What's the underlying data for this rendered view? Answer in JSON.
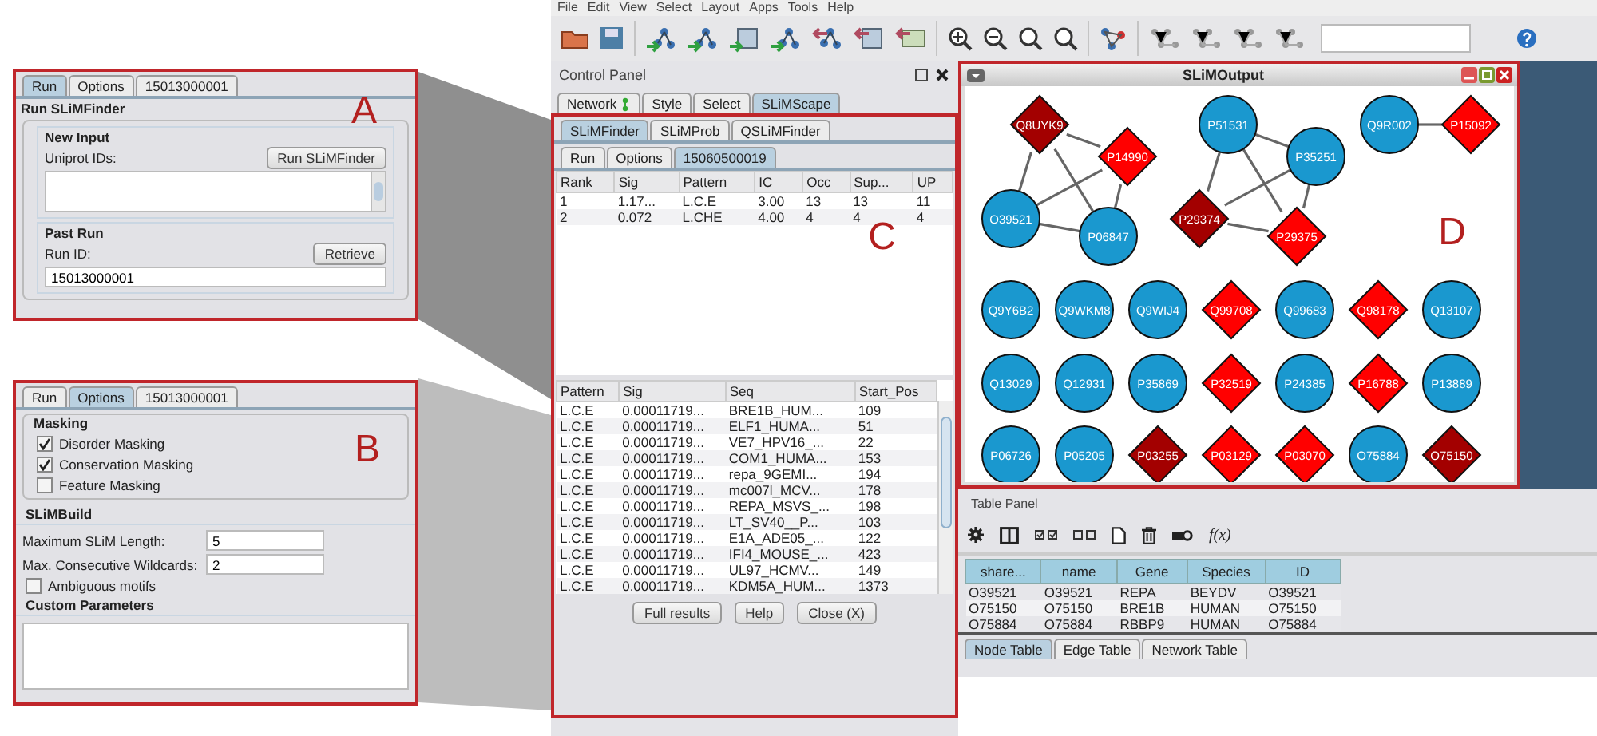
{
  "panel_a": {
    "label": "A",
    "tabs": [
      {
        "label": "Run",
        "selected": true
      },
      {
        "label": "Options",
        "selected": false
      },
      {
        "label": "15013000001",
        "selected": false
      }
    ],
    "title": "Run SLiMFinder",
    "new_input": {
      "heading": "New Input",
      "field_label": "Uniprot IDs:",
      "button": "Run SLiMFinder"
    },
    "past_run": {
      "heading": "Past Run",
      "field_label": "Run ID:",
      "button": "Retrieve",
      "value": "15013000001"
    }
  },
  "panel_b": {
    "label": "B",
    "tabs": [
      {
        "label": "Run",
        "selected": false
      },
      {
        "label": "Options",
        "selected": true
      },
      {
        "label": "15013000001",
        "selected": false
      }
    ],
    "masking": {
      "heading": "Masking",
      "options": [
        {
          "label": "Disorder Masking",
          "checked": true
        },
        {
          "label": "Conservation Masking",
          "checked": true
        },
        {
          "label": "Feature Masking",
          "checked": false
        }
      ]
    },
    "slimbuild": {
      "heading": "SLiMBuild",
      "fields": [
        {
          "label": "Maximum SLiM Length:",
          "value": "5"
        },
        {
          "label": "Max. Consecutive Wildcards:",
          "value": "2"
        }
      ],
      "options": [
        {
          "label": "Ambiguous motifs",
          "checked": false
        }
      ]
    },
    "custom": {
      "heading": "Custom Parameters"
    }
  },
  "app": {
    "menu": [
      "File",
      "Edit",
      "View",
      "Select",
      "Layout",
      "Apps",
      "Tools",
      "Help"
    ],
    "control_panel": {
      "title": "Control Panel",
      "tabs": [
        {
          "label": "Network",
          "selected": false
        },
        {
          "label": "Style",
          "selected": false
        },
        {
          "label": "Select",
          "selected": false
        },
        {
          "label": "SLiMScape",
          "selected": true
        }
      ],
      "label": "C",
      "tool_tabs": [
        {
          "label": "SLiMFinder",
          "selected": true
        },
        {
          "label": "SLiMProb",
          "selected": false
        },
        {
          "label": "QSLiMFinder",
          "selected": false
        }
      ],
      "run_tabs": [
        {
          "label": "Run",
          "selected": false
        },
        {
          "label": "Options",
          "selected": false
        },
        {
          "label": "15060500019",
          "selected": true
        }
      ],
      "motif_table": {
        "columns": [
          "Rank",
          "Sig",
          "Pattern",
          "IC",
          "Occ",
          "Sup...",
          "UP"
        ],
        "rows": [
          [
            "1",
            "1.17...",
            "L.C.E",
            "3.00",
            "13",
            "13",
            "11"
          ],
          [
            "2",
            "0.072",
            "L.CHE",
            "4.00",
            "4",
            "4",
            "4"
          ]
        ]
      },
      "occurrence_table": {
        "columns": [
          "Pattern",
          "Sig",
          "Seq",
          "Start_Pos"
        ],
        "rows": [
          [
            "L.C.E",
            "0.00011719...",
            "BRE1B_HUM...",
            "109"
          ],
          [
            "L.C.E",
            "0.00011719...",
            "ELF1_HUMA...",
            "51"
          ],
          [
            "L.C.E",
            "0.00011719...",
            "VE7_HPV16_...",
            "22"
          ],
          [
            "L.C.E",
            "0.00011719...",
            "COM1_HUMA...",
            "153"
          ],
          [
            "L.C.E",
            "0.00011719...",
            "repa_9GEMI...",
            "194"
          ],
          [
            "L.C.E",
            "0.00011719...",
            "mc007l_MCV...",
            "178"
          ],
          [
            "L.C.E",
            "0.00011719...",
            "REPA_MSVS_...",
            "198"
          ],
          [
            "L.C.E",
            "0.00011719...",
            "LT_SV40__P...",
            "103"
          ],
          [
            "L.C.E",
            "0.00011719...",
            "E1A_ADE05_...",
            "122"
          ],
          [
            "L.C.E",
            "0.00011719...",
            "IFI4_MOUSE_...",
            "423"
          ],
          [
            "L.C.E",
            "0.00011719...",
            "UL97_HCMV...",
            "149"
          ],
          [
            "L.C.E",
            "0.00011719...",
            "KDM5A_HUM...",
            "1373"
          ]
        ]
      },
      "buttons": [
        "Full results",
        "Help",
        "Close (X)"
      ]
    },
    "network_window": {
      "title": "SLiMOutput",
      "label": "D",
      "nodes": [
        {
          "label": "Q8UYK9",
          "kind": "diamond",
          "color": "#a30000"
        },
        {
          "label": "P14990",
          "kind": "diamond",
          "color": "#ff0000"
        },
        {
          "label": "O39521",
          "kind": "circle",
          "color": "#1a98cf"
        },
        {
          "label": "P06847",
          "kind": "circle",
          "color": "#1a98cf"
        },
        {
          "label": "P51531",
          "kind": "circle",
          "color": "#1a98cf"
        },
        {
          "label": "P35251",
          "kind": "circle",
          "color": "#1a98cf"
        },
        {
          "label": "P29374",
          "kind": "diamond",
          "color": "#a30000"
        },
        {
          "label": "P29375",
          "kind": "diamond",
          "color": "#ff0000"
        },
        {
          "label": "Q9R002",
          "kind": "circle",
          "color": "#1a98cf"
        },
        {
          "label": "P15092",
          "kind": "diamond",
          "color": "#ff0000"
        },
        {
          "label": "Q9Y6B2",
          "kind": "circle",
          "color": "#1a98cf"
        },
        {
          "label": "Q9WKM8",
          "kind": "circle",
          "color": "#1a98cf"
        },
        {
          "label": "Q9WIJ4",
          "kind": "circle",
          "color": "#1a98cf"
        },
        {
          "label": "Q99708",
          "kind": "diamond",
          "color": "#ff0000"
        },
        {
          "label": "Q99683",
          "kind": "circle",
          "color": "#1a98cf"
        },
        {
          "label": "Q98178",
          "kind": "diamond",
          "color": "#ff0000"
        },
        {
          "label": "Q13107",
          "kind": "circle",
          "color": "#1a98cf"
        },
        {
          "label": "Q13029",
          "kind": "circle",
          "color": "#1a98cf"
        },
        {
          "label": "Q12931",
          "kind": "circle",
          "color": "#1a98cf"
        },
        {
          "label": "P35869",
          "kind": "circle",
          "color": "#1a98cf"
        },
        {
          "label": "P32519",
          "kind": "diamond",
          "color": "#ff0000"
        },
        {
          "label": "P24385",
          "kind": "circle",
          "color": "#1a98cf"
        },
        {
          "label": "P16788",
          "kind": "diamond",
          "color": "#ff0000"
        },
        {
          "label": "P13889",
          "kind": "circle",
          "color": "#1a98cf"
        },
        {
          "label": "P06726",
          "kind": "circle",
          "color": "#1a98cf"
        },
        {
          "label": "P05205",
          "kind": "circle",
          "color": "#1a98cf"
        },
        {
          "label": "P03255",
          "kind": "diamond",
          "color": "#a30000"
        },
        {
          "label": "P03129",
          "kind": "diamond",
          "color": "#ff0000"
        },
        {
          "label": "P03070",
          "kind": "diamond",
          "color": "#ff0000"
        },
        {
          "label": "O75884",
          "kind": "circle",
          "color": "#1a98cf"
        },
        {
          "label": "O75150",
          "kind": "diamond",
          "color": "#a30000"
        }
      ]
    },
    "table_panel": {
      "title": "Table Panel",
      "formula_button": "f(x)",
      "columns": [
        "share...",
        "name",
        "Gene",
        "Species",
        "ID"
      ],
      "rows": [
        [
          "O39521",
          "O39521",
          "REPA",
          "BEYDV",
          "O39521"
        ],
        [
          "O75150",
          "O75150",
          "BRE1B",
          "HUMAN",
          "O75150"
        ],
        [
          "O75884",
          "O75884",
          "RBBP9",
          "HUMAN",
          "O75884"
        ]
      ],
      "tabs": [
        {
          "label": "Node Table",
          "selected": true
        },
        {
          "label": "Edge Table",
          "selected": false
        },
        {
          "label": "Network Table",
          "selected": false
        }
      ]
    }
  }
}
